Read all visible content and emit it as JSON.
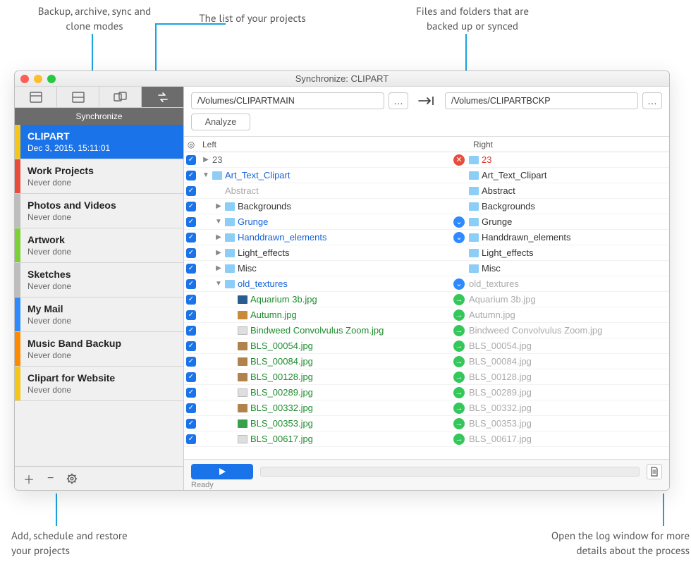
{
  "callouts": {
    "modes": "Backup, archive, sync and\nclone modes",
    "projects": "The list of your projects",
    "files": "Files and folders that are\nbacked up or synced",
    "addrestore": "Add, schedule and restore\nyour projects",
    "log": "Open the log window for more\ndetails about the process"
  },
  "window": {
    "title": "Synchronize: CLIPART"
  },
  "toolbar": {
    "sync_label": "Synchronize"
  },
  "paths": {
    "left": "/Volumes/CLIPARTMAIN",
    "right": "/Volumes/CLIPARTBCKP",
    "analyze": "Analyze"
  },
  "headers": {
    "left": "Left",
    "right": "Right"
  },
  "projects": [
    {
      "name": "CLIPART",
      "sub": "Dec 3, 2015, 15:11:01",
      "stripe": "#f5c518",
      "active": true
    },
    {
      "name": "Work Projects",
      "sub": "Never done",
      "stripe": "#e74c3c"
    },
    {
      "name": "Photos and Videos",
      "sub": "Never done",
      "stripe": "#bdbdbd"
    },
    {
      "name": "Artwork",
      "sub": "Never done",
      "stripe": "#7bd135"
    },
    {
      "name": "Sketches",
      "sub": "Never done",
      "stripe": "#bdbdbd"
    },
    {
      "name": "My Mail",
      "sub": "Never done",
      "stripe": "#2d8bff"
    },
    {
      "name": "Music Band Backup",
      "sub": "Never done",
      "stripe": "#ff8a00"
    },
    {
      "name": "Clipart for Website",
      "sub": "Never done",
      "stripe": "#f5c518"
    }
  ],
  "rows": [
    {
      "indent": 0,
      "arrow": "right",
      "icon": "",
      "lname": "23",
      "lclass": "t-muted",
      "mid": "del",
      "ricon": "folder",
      "rname": "23",
      "rclass": "t-red"
    },
    {
      "indent": 0,
      "arrow": "down",
      "icon": "folder",
      "lname": "Art_Text_Clipart",
      "lclass": "t-blue",
      "mid": "",
      "ricon": "folder",
      "rname": "Art_Text_Clipart",
      "rclass": ""
    },
    {
      "indent": 1,
      "arrow": "",
      "icon": "",
      "lname": "Abstract",
      "lclass": "t-gray",
      "mid": "",
      "ricon": "folder",
      "rname": "Abstract",
      "rclass": ""
    },
    {
      "indent": 1,
      "arrow": "right",
      "icon": "folder",
      "lname": "Backgrounds",
      "lclass": "",
      "mid": "",
      "ricon": "folder",
      "rname": "Backgrounds",
      "rclass": ""
    },
    {
      "indent": 1,
      "arrow": "down",
      "icon": "folder",
      "lname": "Grunge",
      "lclass": "t-blue",
      "mid": "chev",
      "ricon": "folder",
      "rname": "Grunge",
      "rclass": ""
    },
    {
      "indent": 1,
      "arrow": "right",
      "icon": "folder",
      "lname": "Handdrawn_elements",
      "lclass": "t-blue",
      "mid": "chev",
      "ricon": "folder",
      "rname": "Handdrawn_elements",
      "rclass": ""
    },
    {
      "indent": 1,
      "arrow": "right",
      "icon": "folder",
      "lname": "Light_effects",
      "lclass": "",
      "mid": "",
      "ricon": "folder",
      "rname": "Light_effects",
      "rclass": ""
    },
    {
      "indent": 1,
      "arrow": "right",
      "icon": "folder",
      "lname": "Misc",
      "lclass": "",
      "mid": "",
      "ricon": "folder",
      "rname": "Misc",
      "rclass": ""
    },
    {
      "indent": 1,
      "arrow": "down",
      "icon": "folder",
      "lname": "old_textures",
      "lclass": "t-blue",
      "mid": "chev",
      "ricon": "",
      "rname": "old_textures",
      "rclass": "t-gray"
    },
    {
      "indent": 2,
      "arrow": "",
      "icon": "imgA",
      "lname": "Aquarium 3b.jpg",
      "lclass": "t-green",
      "mid": "go",
      "ricon": "",
      "rname": "Aquarium 3b.jpg",
      "rclass": "t-gray"
    },
    {
      "indent": 2,
      "arrow": "",
      "icon": "imgB",
      "lname": "Autumn.jpg",
      "lclass": "t-green",
      "mid": "go",
      "ricon": "",
      "rname": "Autumn.jpg",
      "rclass": "t-gray"
    },
    {
      "indent": 2,
      "arrow": "",
      "icon": "imgC",
      "lname": "Bindweed Convolvulus Zoom.jpg",
      "lclass": "t-green",
      "mid": "go",
      "ricon": "",
      "rname": "Bindweed Convolvulus Zoom.jpg",
      "rclass": "t-gray"
    },
    {
      "indent": 2,
      "arrow": "",
      "icon": "imgD",
      "lname": "BLS_00054.jpg",
      "lclass": "t-green",
      "mid": "go",
      "ricon": "",
      "rname": "BLS_00054.jpg",
      "rclass": "t-gray"
    },
    {
      "indent": 2,
      "arrow": "",
      "icon": "imgD",
      "lname": "BLS_00084.jpg",
      "lclass": "t-green",
      "mid": "go",
      "ricon": "",
      "rname": "BLS_00084.jpg",
      "rclass": "t-gray"
    },
    {
      "indent": 2,
      "arrow": "",
      "icon": "imgD",
      "lname": "BLS_00128.jpg",
      "lclass": "t-green",
      "mid": "go",
      "ricon": "",
      "rname": "BLS_00128.jpg",
      "rclass": "t-gray"
    },
    {
      "indent": 2,
      "arrow": "",
      "icon": "imgC",
      "lname": "BLS_00289.jpg",
      "lclass": "t-green",
      "mid": "go",
      "ricon": "",
      "rname": "BLS_00289.jpg",
      "rclass": "t-gray"
    },
    {
      "indent": 2,
      "arrow": "",
      "icon": "imgD",
      "lname": "BLS_00332.jpg",
      "lclass": "t-green",
      "mid": "go",
      "ricon": "",
      "rname": "BLS_00332.jpg",
      "rclass": "t-gray"
    },
    {
      "indent": 2,
      "arrow": "",
      "icon": "imgE",
      "lname": "BLS_00353.jpg",
      "lclass": "t-green",
      "mid": "go",
      "ricon": "",
      "rname": "BLS_00353.jpg",
      "rclass": "t-gray"
    },
    {
      "indent": 2,
      "arrow": "",
      "icon": "imgC",
      "lname": "BLS_00617.jpg",
      "lclass": "t-green",
      "mid": "go",
      "ricon": "",
      "rname": "BLS_00617.jpg",
      "rclass": "t-gray"
    }
  ],
  "footer": {
    "status": "Ready"
  }
}
